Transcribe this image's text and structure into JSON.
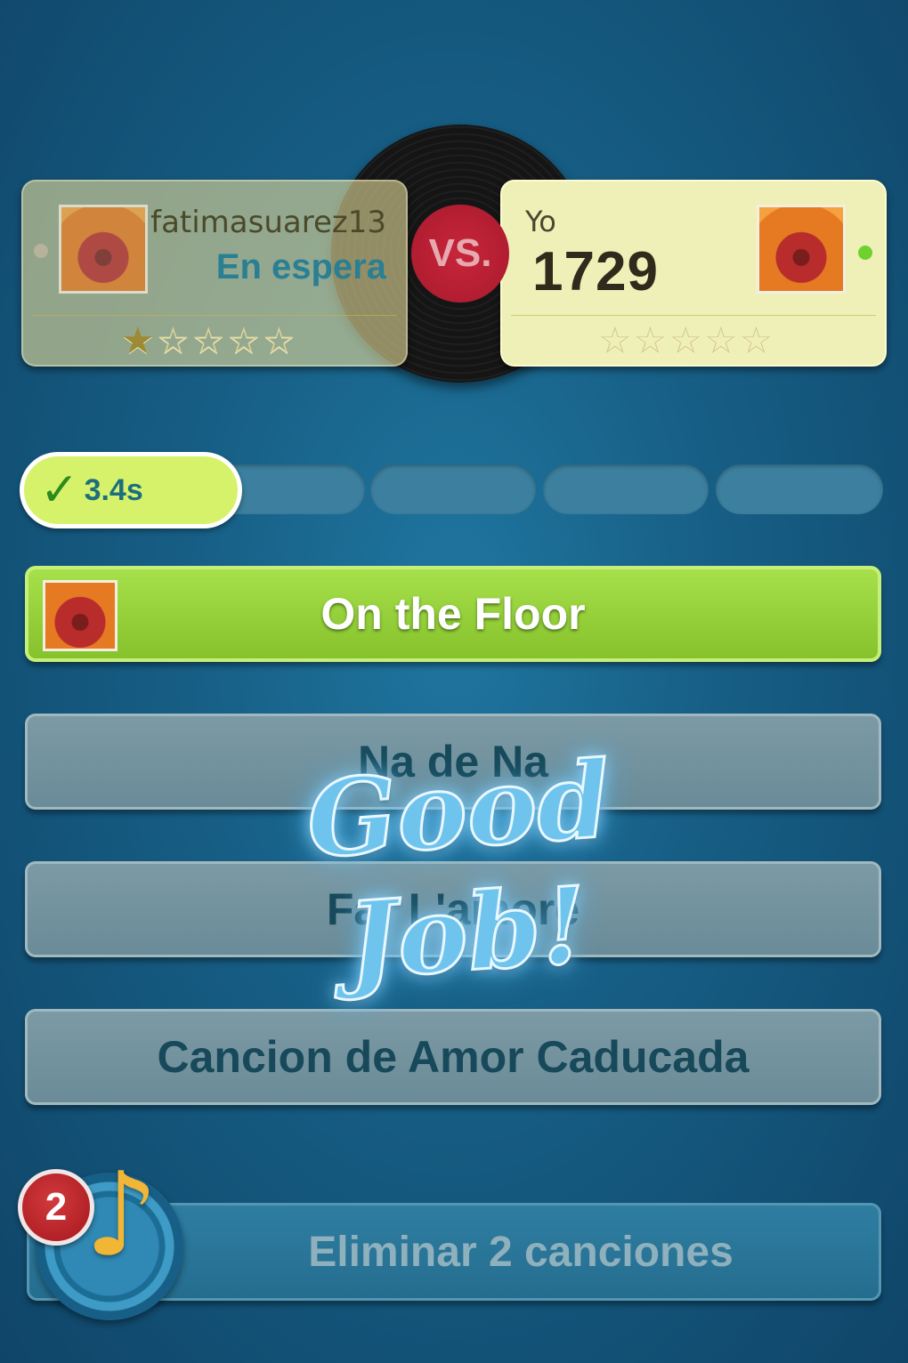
{
  "opponent": {
    "name": "fatimasuarez13",
    "status": "En espera",
    "stars_filled": 1,
    "stars_total": 5
  },
  "vs_label": "VS.",
  "me": {
    "label": "Yo",
    "score": "1729",
    "stars_filled": 0,
    "stars_total": 5
  },
  "progress": {
    "time": "3.4s",
    "rounds_completed": 1,
    "rounds_total": 5
  },
  "answers": [
    {
      "title": "On the Floor",
      "state": "correct"
    },
    {
      "title": "Na de Na",
      "state": "default"
    },
    {
      "title": "Far L'amore",
      "state": "default"
    },
    {
      "title": "Cancion de Amor Caducada",
      "state": "default"
    }
  ],
  "overlay": {
    "text": "Good Job!"
  },
  "powerup": {
    "label": "Eliminar 2 canciones",
    "count": "2"
  },
  "icons": {
    "check": "check-icon",
    "star": "star-icon",
    "music_note": "music-note-icon",
    "record": "vinyl-record-icon"
  },
  "colors": {
    "correct_green": "#9bd63d",
    "progress_pill": "#d6f26a",
    "badge_red": "#c0282e",
    "note_gold": "#f2b637",
    "background": "#175f86"
  }
}
